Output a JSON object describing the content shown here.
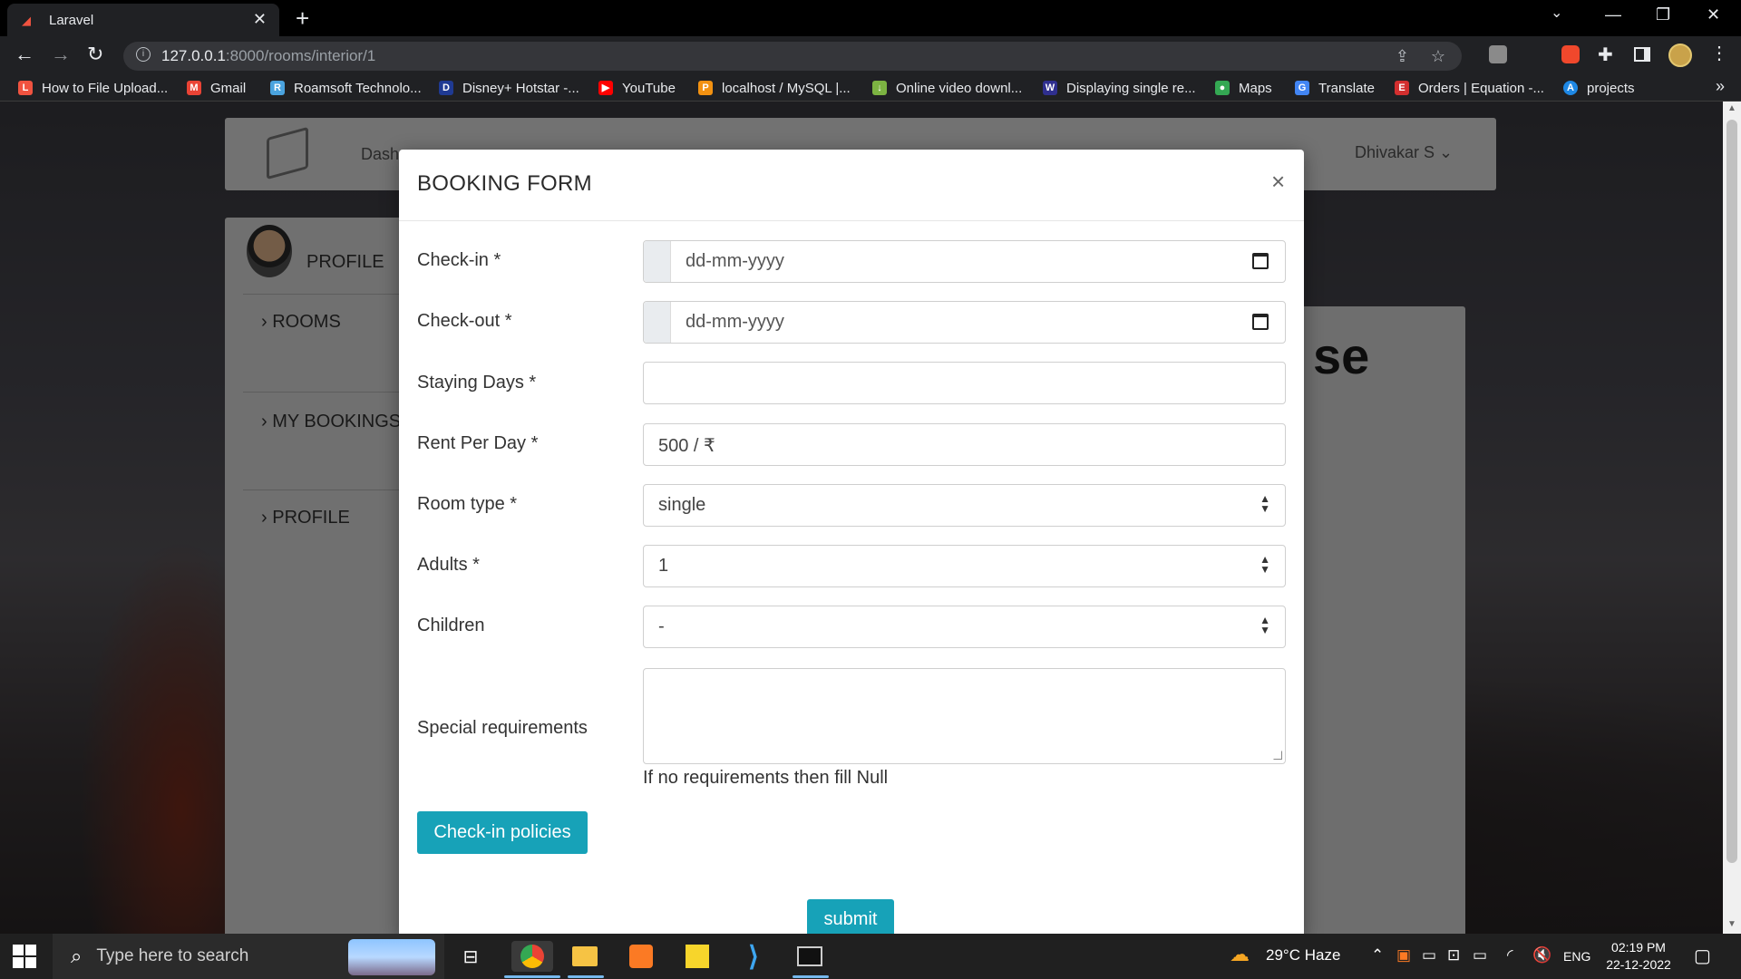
{
  "browser": {
    "tab_title": "Laravel",
    "new_tab_symbol": "+",
    "url_host": "127.0.0.1",
    "url_rest": ":8000/rooms/interior/1",
    "window_controls": [
      "—",
      "❐",
      "✕"
    ]
  },
  "bookmarks": [
    {
      "label": "How to File Upload...",
      "icon": "laravel-icon",
      "color": "#f05340"
    },
    {
      "label": "Gmail",
      "icon": "gmail-icon",
      "color": "#ea4335"
    },
    {
      "label": "Roamsoft Technolo...",
      "icon": "roamsoft-icon",
      "color": "#4aa3df"
    },
    {
      "label": "Disney+ Hotstar -...",
      "icon": "hotstar-icon",
      "color": "#1f3a93"
    },
    {
      "label": "YouTube",
      "icon": "youtube-icon",
      "color": "#ff0000"
    },
    {
      "label": "localhost / MySQL |...",
      "icon": "phpmyadmin-icon",
      "color": "#f29111"
    },
    {
      "label": "Online video downl...",
      "icon": "download-icon",
      "color": "#7cb342"
    },
    {
      "label": "Displaying single re...",
      "icon": "w3-icon",
      "color": "#2f2f8f"
    },
    {
      "label": "Maps",
      "icon": "maps-icon",
      "color": "#34a853"
    },
    {
      "label": "Translate",
      "icon": "translate-icon",
      "color": "#4285f4"
    },
    {
      "label": "Orders | Equation -...",
      "icon": "equation-icon",
      "color": "#d32f2f"
    },
    {
      "label": "projects",
      "icon": "projects-icon",
      "color": "#1e88e5"
    }
  ],
  "bookmarks_more": "»",
  "background": {
    "nav_dashboard": "Dash",
    "user_name": "Dhivakar S",
    "sidebar_profile": "PROFILE",
    "sidebar_items": [
      "ROOMS",
      "MY BOOKINGS",
      "PROFILE"
    ],
    "card_heading_fragment": "se"
  },
  "modal": {
    "title": "BOOKING FORM",
    "close": "×",
    "fields": {
      "checkin": {
        "label": "Check-in *",
        "placeholder": "dd-mm-yyyy"
      },
      "checkout": {
        "label": "Check-out *",
        "placeholder": "dd-mm-yyyy"
      },
      "staying_days": {
        "label": "Staying Days *",
        "value": ""
      },
      "rent": {
        "label": "Rent Per Day *",
        "value": "500 / ₹"
      },
      "room_type": {
        "label": "Room type *",
        "value": "single"
      },
      "adults": {
        "label": "Adults *",
        "value": "1"
      },
      "children": {
        "label": "Children",
        "value": "-"
      },
      "special": {
        "label": "Special requirements",
        "value": "",
        "hint": "If no requirements then fill Null"
      }
    },
    "policies_button": "Check-in policies",
    "submit_button": "submit"
  },
  "taskbar": {
    "search_placeholder": "Type here to search",
    "weather": "29°C  Haze",
    "language": "ENG",
    "time": "02:19 PM",
    "date": "22-12-2022",
    "accent": "#76b9ed"
  }
}
